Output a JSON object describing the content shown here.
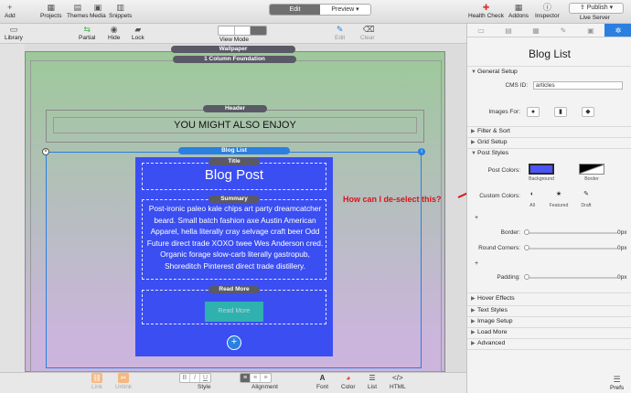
{
  "toolbar": {
    "add": "Add",
    "projects": "Projects",
    "themes": "Themes",
    "media": "Media",
    "snippets": "Snippets",
    "edit": "Edit",
    "preview": "Preview",
    "health_check": "Health Check",
    "addons": "Addons",
    "inspector": "Inspector",
    "publish": "Publish",
    "live_server": "Live Server"
  },
  "toolbar2": {
    "library": "Library",
    "partial": "Partial",
    "hide": "Hide",
    "lock": "Lock",
    "view_mode": "View Mode",
    "edit": "Edit",
    "clear": "Clear"
  },
  "canvas": {
    "wallpaper": "Wallpaper",
    "foundation": "1 Column Foundation",
    "header_label": "Header",
    "header_text": "YOU MIGHT ALSO ENJOY",
    "bloglist_label": "Blog List",
    "title_label": "Title",
    "blog_title": "Blog Post",
    "summary_label": "Summary",
    "summary_text": "Post-ironic paleo kale chips art party dreamcatcher beard. Small batch fashion axe Austin American Apparel, hella literally cray selvage craft beer Odd Future direct trade XOXO twee Wes Anderson cred. Organic forage slow-carb literally gastropub, Shoreditch Pinterest direct trade distillery.",
    "readmore_label": "Read More",
    "readmore_button": "Read More",
    "plus": "+"
  },
  "bottombar": {
    "link": "Link",
    "unlink": "Unlink",
    "style": "Style",
    "alignment": "Alignment",
    "font": "Font",
    "color": "Color",
    "list": "List",
    "html": "HTML"
  },
  "inspector": {
    "title": "Blog List",
    "general_setup": "General Setup",
    "cms_id_label": "CMS ID:",
    "cms_id_value": "articles",
    "images_for_label": "Images For:",
    "filter_sort": "Filter & Sort",
    "grid_setup": "Grid Setup",
    "post_styles": "Post Styles",
    "post_colors_label": "Post Colors:",
    "background_label": "Background",
    "border_label": "Border",
    "custom_colors_label": "Custom Colors:",
    "all_label": "All",
    "featured_label": "Featured",
    "draft_label": "Draft",
    "border_slider_label": "Border:",
    "border_value": "0px",
    "round_corners_label": "Round Corners:",
    "round_corners_value": "0px",
    "padding_label": "Padding:",
    "padding_value": "0px",
    "hover_effects": "Hover Effects",
    "text_styles": "Text Styles",
    "image_setup": "Image Setup",
    "load_more": "Load More",
    "advanced": "Advanced",
    "prefs": "Prefs",
    "background_color": "#4a55f5",
    "border_swatch": "gradient black-white"
  },
  "annotation": {
    "question": "How can I de-select this?",
    "color": "#d9141a"
  }
}
